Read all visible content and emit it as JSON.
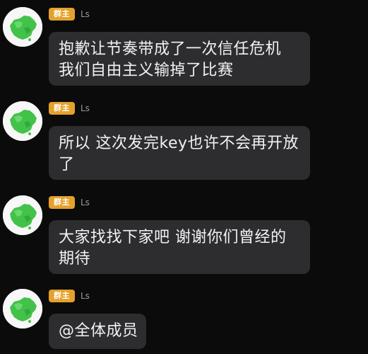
{
  "messages": [
    {
      "role_badge": "群主",
      "sender": "Ls",
      "lines": [
        "抱歉让节奏带成了一次信任危机",
        "我们自由主义输掉了比赛"
      ]
    },
    {
      "role_badge": "群主",
      "sender": "Ls",
      "lines": [
        "所以 这次发完key也许不会再开放",
        "了"
      ]
    },
    {
      "role_badge": "群主",
      "sender": "Ls",
      "lines": [
        "大家找找下家吧 谢谢你们曾经的",
        "期待"
      ]
    },
    {
      "role_badge": "群主",
      "sender": "Ls",
      "lines": [
        "@全体成员"
      ]
    }
  ],
  "colors": {
    "background": "#0b0b0c",
    "bubble": "#2d2d30",
    "badge": "#e4a12b",
    "avatar_map": "#43c24a"
  },
  "icons": {
    "avatar": "china-map-avatar-icon"
  }
}
